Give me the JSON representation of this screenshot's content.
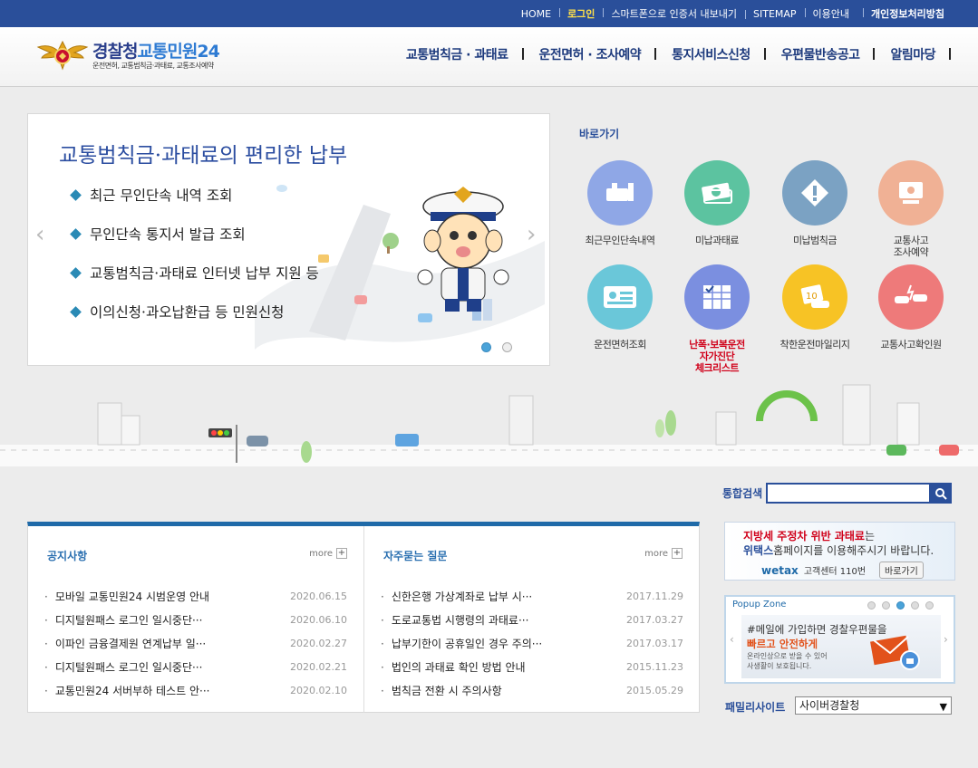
{
  "topbar": {
    "links": [
      "HOME",
      "로그인",
      "스마트폰으로 인증서 내보내기",
      "SITEMAP",
      "이용안내",
      "개인정보처리방침"
    ]
  },
  "logo": {
    "title_main": "경찰청",
    "title_accent": "교통민원24",
    "subtitle": "운전면허, 교통범칙금·과태료, 교통조사예약"
  },
  "gnb": [
    "교통범칙금 · 과태료",
    "운전면허 · 조사예약",
    "통지서비스신청",
    "우편물반송공고",
    "알림마당"
  ],
  "slider": {
    "title": "교통범칙금·과태료의 편리한 납부",
    "items": [
      "최근 무인단속 내역 조회",
      "무인단속 통지서 발급 조회",
      "교통범칙금·과태료 인터넷 납부 지원 등",
      "이의신청·과오납환급 등 민원신청"
    ],
    "prev": "‹",
    "next": "›"
  },
  "quick": {
    "title": "바로가기",
    "items": [
      {
        "label": "최근무인단속내역",
        "color": "#8fa7e6",
        "icon": "camera-icon"
      },
      {
        "label": "미납과태료",
        "color": "#5cc3a0",
        "icon": "money-icon"
      },
      {
        "label": "미납범칙금",
        "color": "#7ba2c3",
        "icon": "warning-icon"
      },
      {
        "label": "교통사고\n조사예약",
        "color": "#f0b195",
        "icon": "monitor-icon"
      },
      {
        "label": "운전면허조회",
        "color": "#6ac7d9",
        "icon": "license-icon"
      },
      {
        "label": "난폭·보복운전\n자가진단\n체크리스트",
        "color": "#7b8fe0",
        "icon": "checklist-icon"
      },
      {
        "label": "착한운전마일리지",
        "color": "#f7c325",
        "icon": "mileage-icon"
      },
      {
        "label": "교통사고확인원",
        "color": "#ee7a7a",
        "icon": "accident-icon"
      }
    ]
  },
  "search": {
    "label": "통합검색",
    "value": ""
  },
  "notice": {
    "title": "공지사항",
    "more": "more",
    "rows": [
      {
        "text": "모바일 교통민원24 시범운영 안내",
        "date": "2020.06.15"
      },
      {
        "text": "디지털원패스 로그인 일시중단···",
        "date": "2020.06.10"
      },
      {
        "text": "이파인 금융결제원 연계납부 일···",
        "date": "2020.02.27"
      },
      {
        "text": "디지털원패스 로그인 일시중단···",
        "date": "2020.02.21"
      },
      {
        "text": "교통민원24 서버부하 테스트 안···",
        "date": "2020.02.10"
      }
    ]
  },
  "faq": {
    "title": "자주묻는 질문",
    "more": "more",
    "rows": [
      {
        "text": "신한은행 가상계좌로 납부 시···",
        "date": "2017.11.29"
      },
      {
        "text": "도로교통법 시행령의 과태료···",
        "date": "2017.03.27"
      },
      {
        "text": "납부기한이 공휴일인 경우 주의···",
        "date": "2017.03.17"
      },
      {
        "text": "법인의 과태료 확인 방법 안내",
        "date": "2015.11.23"
      },
      {
        "text": "범칙금 전환 시 주의사항",
        "date": "2015.05.29"
      }
    ]
  },
  "wetax": {
    "line1_red": "지방세 주정차 위반 과태료",
    "line1_rest": "는",
    "line2_bold": "위택스",
    "line2_rest": "홈페이지를 이용해주시기 바랍니다.",
    "brand": "wetax",
    "center": "고객센터 110번",
    "button": "바로가기"
  },
  "popup": {
    "title": "Popup Zone",
    "line1": "#메일에 가입하면 경찰우편물을",
    "line2": "빠르고 안전하게",
    "line3a": "온라인상으로 받을 수 있어",
    "line3b": "사생활이 보호됩니다."
  },
  "family": {
    "label": "패밀리사이트",
    "selected": "사이버경찰청"
  }
}
